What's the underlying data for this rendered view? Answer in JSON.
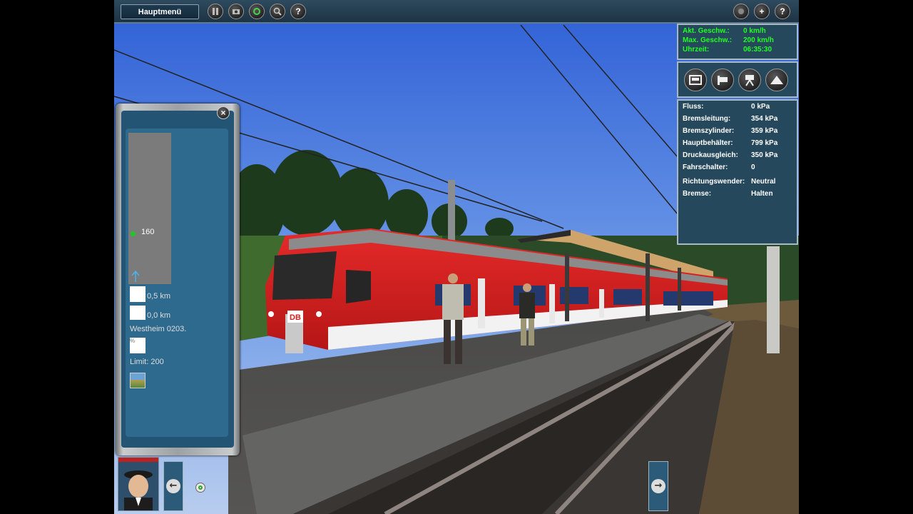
{
  "topbar": {
    "menu_label": "Hauptmenü",
    "left_buttons": [
      "pause-icon",
      "camera-icon",
      "refresh-icon",
      "search-icon",
      "help-icon"
    ],
    "right_buttons": [
      "record-icon",
      "plus-icon",
      "help-icon"
    ],
    "help_glyph": "?",
    "plus_glyph": "+"
  },
  "status": {
    "speed_label": "Akt. Geschw.:",
    "speed_value": "0 km/h",
    "maxspeed_label": "Max. Geschw.:",
    "maxspeed_value": "200 km/h",
    "time_label": "Uhrzeit:",
    "time_value": "06:35:30"
  },
  "view_buttons": [
    "cab-view-icon",
    "exterior-view-icon",
    "trackside-camera-icon",
    "terrain-view-icon"
  ],
  "brake_info": {
    "rows": [
      {
        "label": "Fluss:",
        "value": "0 kPa"
      },
      {
        "label": "Bremsleitung:",
        "value": "354 kPa"
      },
      {
        "label": "Bremszylinder:",
        "value": "359 kPa"
      },
      {
        "label": "Hauptbehälter:",
        "value": "799 kPa"
      },
      {
        "label": "Druckausgleich:",
        "value": "350 kPa"
      },
      {
        "label": "Fahrschalter:",
        "value": "0"
      }
    ],
    "rows2": [
      {
        "label": "Richtungswender:",
        "value": "Neutral"
      },
      {
        "label": "Bremse:",
        "value": "Halten"
      }
    ]
  },
  "track_monitor": {
    "speed_marker": "160",
    "dist1": "0,5 km",
    "dist2": "0,0 km",
    "station": "Westheim 0203.",
    "percent_glyph": "%",
    "limit": "Limit: 200"
  },
  "bottom": {
    "left_arrow": "←",
    "right_arrow": "→"
  },
  "train": {
    "logo": "DB"
  },
  "colors": {
    "panel_bg": "#25485d",
    "status_text": "#22ff22",
    "train_red": "#d81e1e"
  }
}
